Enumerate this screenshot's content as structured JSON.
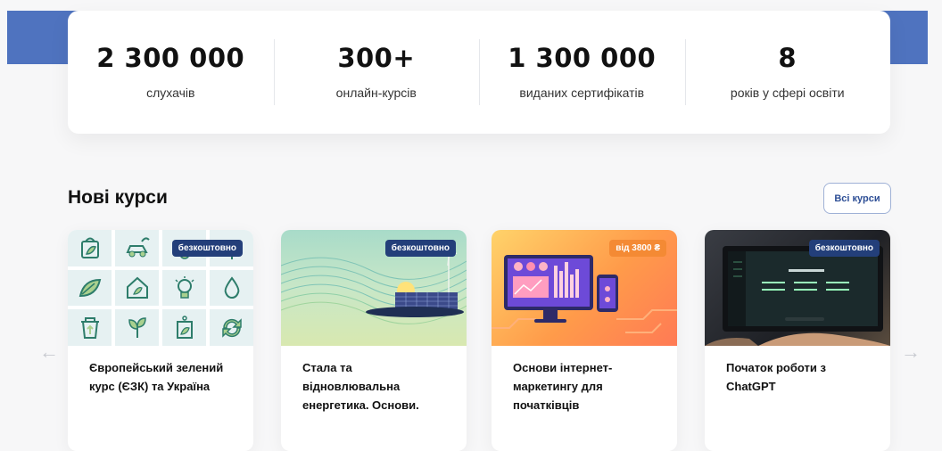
{
  "stats": [
    {
      "value": "2 300 000",
      "label": "слухачів"
    },
    {
      "value": "300+",
      "label": "онлайн-курсів"
    },
    {
      "value": "1 300 000",
      "label": "виданих сертифікатів"
    },
    {
      "value": "8",
      "label": "років у сфері освіти"
    }
  ],
  "section": {
    "title": "Нові курси",
    "all_courses_label": "Всі курси"
  },
  "nav": {
    "prev_icon": "←",
    "next_icon": "→"
  },
  "courses": [
    {
      "badge": "безкоштовно",
      "title": "Європейський зелений курс (ЄЗК) та Україна"
    },
    {
      "badge": "безкоштовно",
      "title": "Стала та відновлювальна енергетика. Основи."
    },
    {
      "badge": "від 3800 ₴",
      "title": "Основи інтернет-маркетингу для початківців"
    },
    {
      "badge": "безкоштовно",
      "title": "Початок роботи з ChatGPT"
    }
  ],
  "colors": {
    "brand_blue": "#233f7a",
    "hero_blue": "#4f73bf",
    "orange_badge": "#f48a34"
  }
}
